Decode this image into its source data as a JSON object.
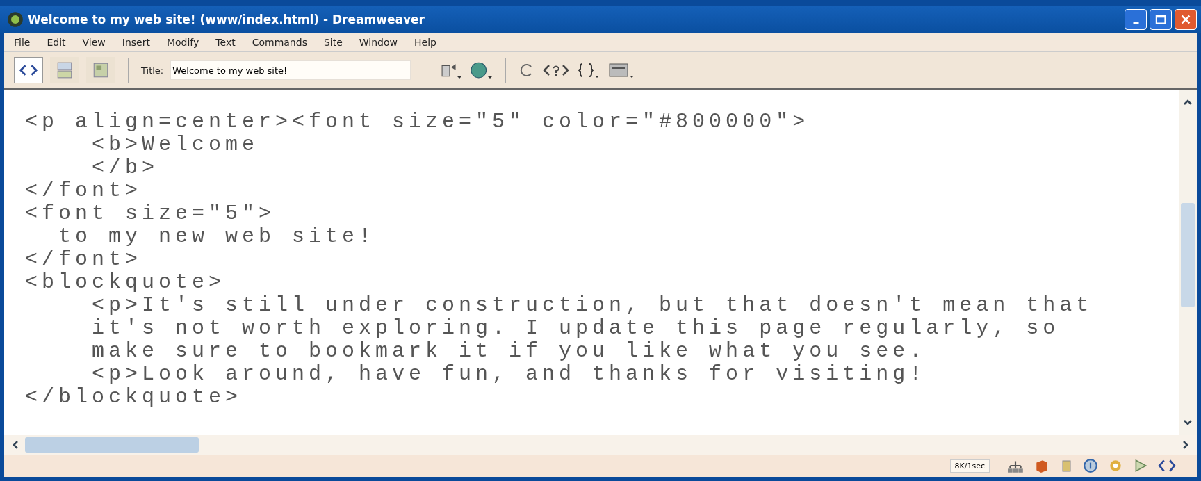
{
  "window": {
    "title": "Welcome to my web site! (www/index.html) - Dreamweaver"
  },
  "menu": [
    "File",
    "Edit",
    "View",
    "Insert",
    "Modify",
    "Text",
    "Commands",
    "Site",
    "Window",
    "Help"
  ],
  "toolbar": {
    "view_buttons": [
      {
        "kind": "code",
        "selected": true
      },
      {
        "kind": "split",
        "selected": false
      },
      {
        "kind": "design",
        "selected": false
      }
    ],
    "title_label": "Title:",
    "title_value": "Welcome to my web site!"
  },
  "code_lines": [
    "<p align=center><font size=\"5\" color=\"#800000\">",
    "    <b>Welcome",
    "    </b>",
    "</font>",
    "<font size=\"5\">",
    "  to my new web site!",
    "</font>",
    "<blockquote>",
    "    <p>It's still under construction, but that doesn't mean that",
    "    it's not worth exploring. I update this page regularly, so",
    "    make sure to bookmark it if you like what you see.",
    "    <p>Look around, have fun, and thanks for visiting!",
    "</blockquote>"
  ],
  "status_bar": {
    "download_stats": "8K/1sec"
  }
}
